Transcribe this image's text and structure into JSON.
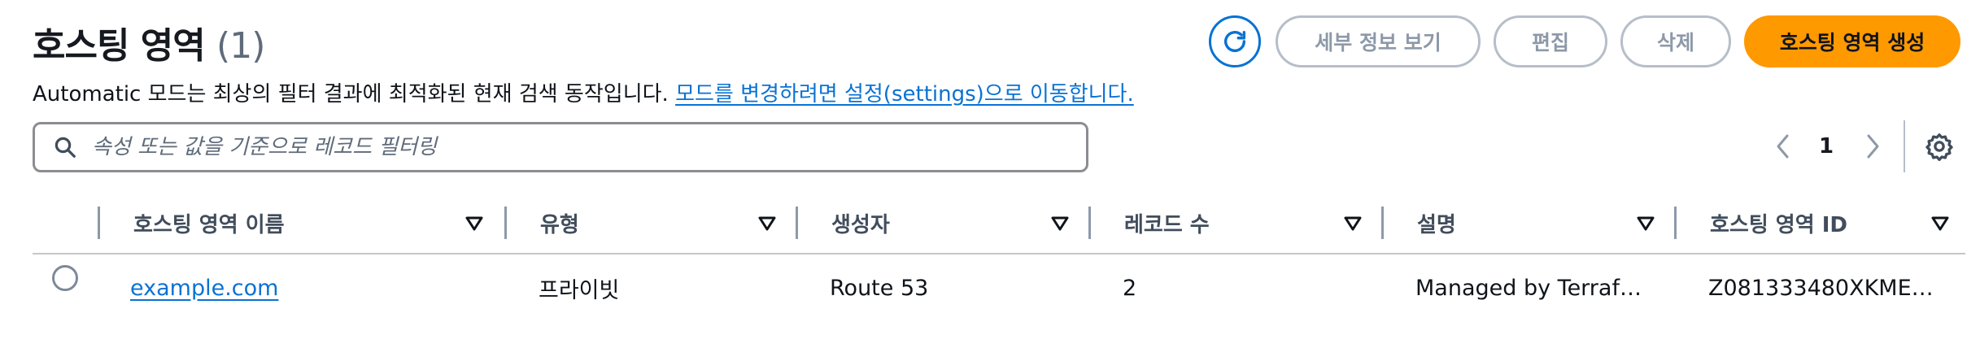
{
  "header": {
    "title": "호스팅 영역",
    "count": "(1)",
    "description": "Automatic 모드는 최상의 필터 결과에 최적화된 현재 검색 동작입니다.",
    "description_link": "모드를 변경하려면 설정(settings)으로 이동합니다."
  },
  "actions": {
    "refresh_icon": "refresh-icon",
    "details_label": "세부 정보 보기",
    "edit_label": "편집",
    "delete_label": "삭제",
    "create_label": "호스팅 영역 생성"
  },
  "search": {
    "placeholder": "속성 또는 값을 기준으로 레코드 필터링",
    "value": ""
  },
  "pagination": {
    "current_page": "1"
  },
  "table": {
    "columns": [
      "호스팅 영역 이름",
      "유형",
      "생성자",
      "레코드 수",
      "설명",
      "호스팅 영역 ID"
    ],
    "rows": [
      {
        "name": "example.com",
        "type": "프라이빗",
        "created_by": "Route 53",
        "record_count": "2",
        "description": "Managed by Terraf…",
        "zone_id": "Z081333480XKME…"
      }
    ]
  },
  "colors": {
    "primary": "#ff9900",
    "link": "#0972d3",
    "disabled_text": "#8d99a8"
  }
}
